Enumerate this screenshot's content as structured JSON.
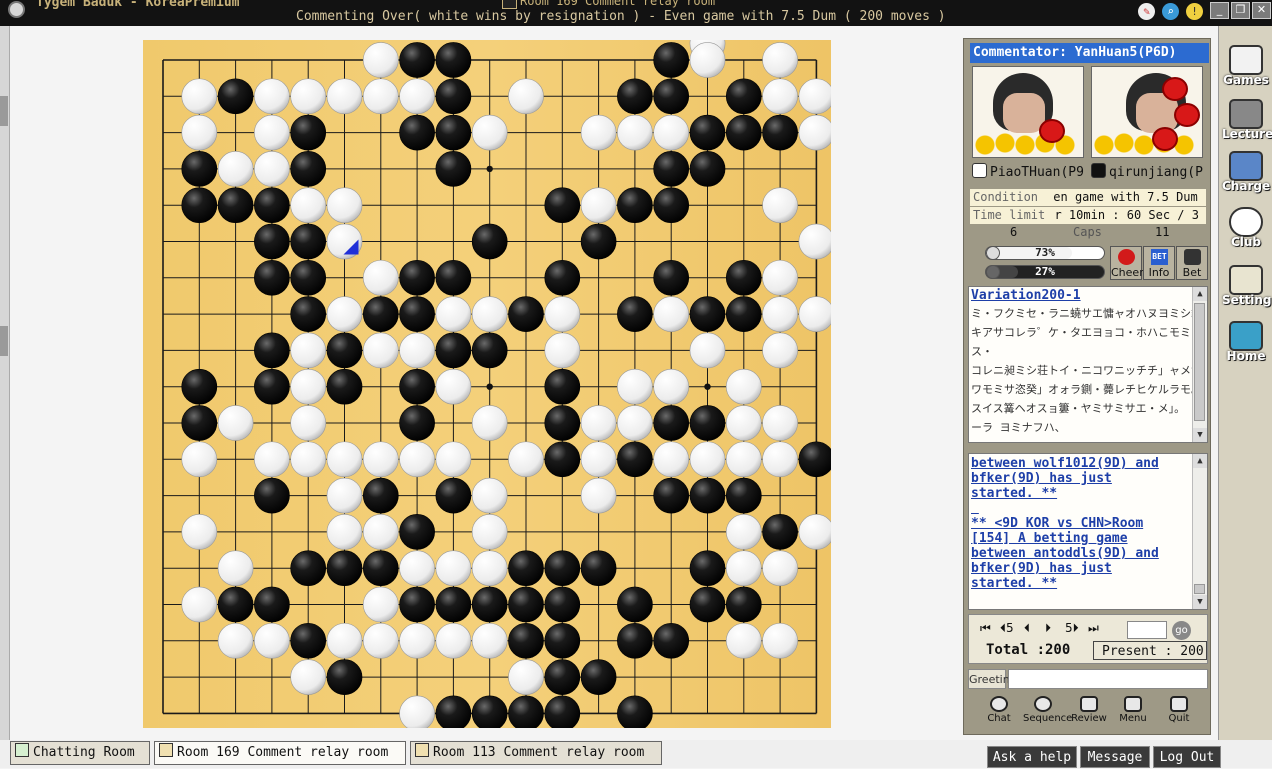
{
  "window": {
    "app_title": "Tygem Baduk - KoreaPremium",
    "room_title": "Room 169 Comment relay room",
    "status": "Commenting Over( white wins by resignation ) - Even game with 7.5 Dum  ( 200 moves )",
    "icons": [
      "paint-icon",
      "search-icon",
      "tip-bulb-icon",
      "minimize-icon",
      "restore-icon",
      "close-icon"
    ]
  },
  "board": {
    "size": 19,
    "stars": [
      [
        3,
        3
      ],
      [
        3,
        9
      ],
      [
        3,
        15
      ],
      [
        9,
        3
      ],
      [
        9,
        9
      ],
      [
        9,
        15
      ],
      [
        15,
        3
      ],
      [
        15,
        9
      ],
      [
        15,
        15
      ]
    ],
    "last_move": [
      5,
      5
    ],
    "rows": [
      "...............W...",
      "......WBB.....BW.W.",
      ".WBWWWWWB.W..BB.BWW",
      ".W.WB..BBW..WWWBBBW",
      ".BWWB...B.....BB...",
      ".BBBWW.....BWBB..W.",
      "...BBW...B..B.....W",
      "...BB.WBB..B..B.BW.",
      "....BWBBWWBW.BWBBWW",
      "...BWBWWBB.W...W.W.",
      ".B.BWB.BW..B.WW.W..",
      ".BW.W..B.W.BWWBBWW.",
      ".W.WWWWWW.WBWBWWWWBB",
      "...B.WB.BW..W.BBB..",
      ".W...WWB.W......WBW",
      "..W.BBBWWWBBB..BWW.",
      ".WBB..WBBBBB.B.BB..",
      "..WWBWWWWWBB.BB.WW.",
      "....WB....WBB......",
      ".......WBBBB.B....."
    ]
  },
  "panel": {
    "commentator": "Commentator: YanHuan5(P6D)",
    "player_white": "PiaoTHuan(P9",
    "player_black": "qirunjiang(P",
    "condition_label": "Condition",
    "condition_value": "en game with 7.5 Dum",
    "time_label": "Time limit",
    "time_value": "r 10min : 60 Sec / 3",
    "caps_label": "Caps",
    "caps_white": "6",
    "caps_black": "11",
    "white_pct_text": "73%",
    "black_pct_text": "27%",
    "white_pct": 0.73,
    "black_pct": 0.27,
    "btn_cheer": "Cheer",
    "btn_info": "Info",
    "btn_bet": "Bet",
    "bet_icon_text": "BET"
  },
  "variation": {
    "title": "Variation200-1",
    "lines": [
      "ミ・フクミセ・ラニ蟯サエ慵ャオハヌヨミシ彝",
      "キアサコレラ゜ケ・タエヨョコ・ホハこモミミウトム",
      "ス・",
      "コレニ昶ミシ荘トイ・ニコワニッチチ」ャメサカネコ",
      "ワモミサ恣癸」オォラ鍘・薨レチヒケルラモ。」",
      "スイス篝ヘオスョ簍・ヤミサミサエ・メ」。",
      "ーラ ヨミナフハ、"
    ]
  },
  "chat": {
    "lines": [
      "between wolf1012(9D) and",
      "bfker(9D) has just",
      "started. **",
      "",
      "** <9D KOR vs CHN>Room",
      "[154] A betting game",
      "between antoddls(9D) and",
      "bfker(9D) has just",
      "started. **"
    ]
  },
  "nav": {
    "first": "⏮",
    "back5": "⏴5",
    "prev": "⏴",
    "next": "⏵",
    "fwd5": "5⏵",
    "last": "⏭",
    "go": "go",
    "total": "Total :200",
    "present": "Present : 200"
  },
  "greeting": "Greeting",
  "tools": [
    "Chat",
    "Sequence",
    "Review",
    "Menu",
    "Quit"
  ],
  "sidemenu": [
    "Games",
    "Lecture",
    "Charge",
    "Club",
    "Setting",
    "Home"
  ],
  "tabs": {
    "chatting": "Chatting Room",
    "room169": "Room 169 Comment relay room",
    "room113": "Room 113 Comment relay room"
  },
  "bottom_buttons": [
    "Ask a help",
    "Message",
    "Log Out"
  ]
}
